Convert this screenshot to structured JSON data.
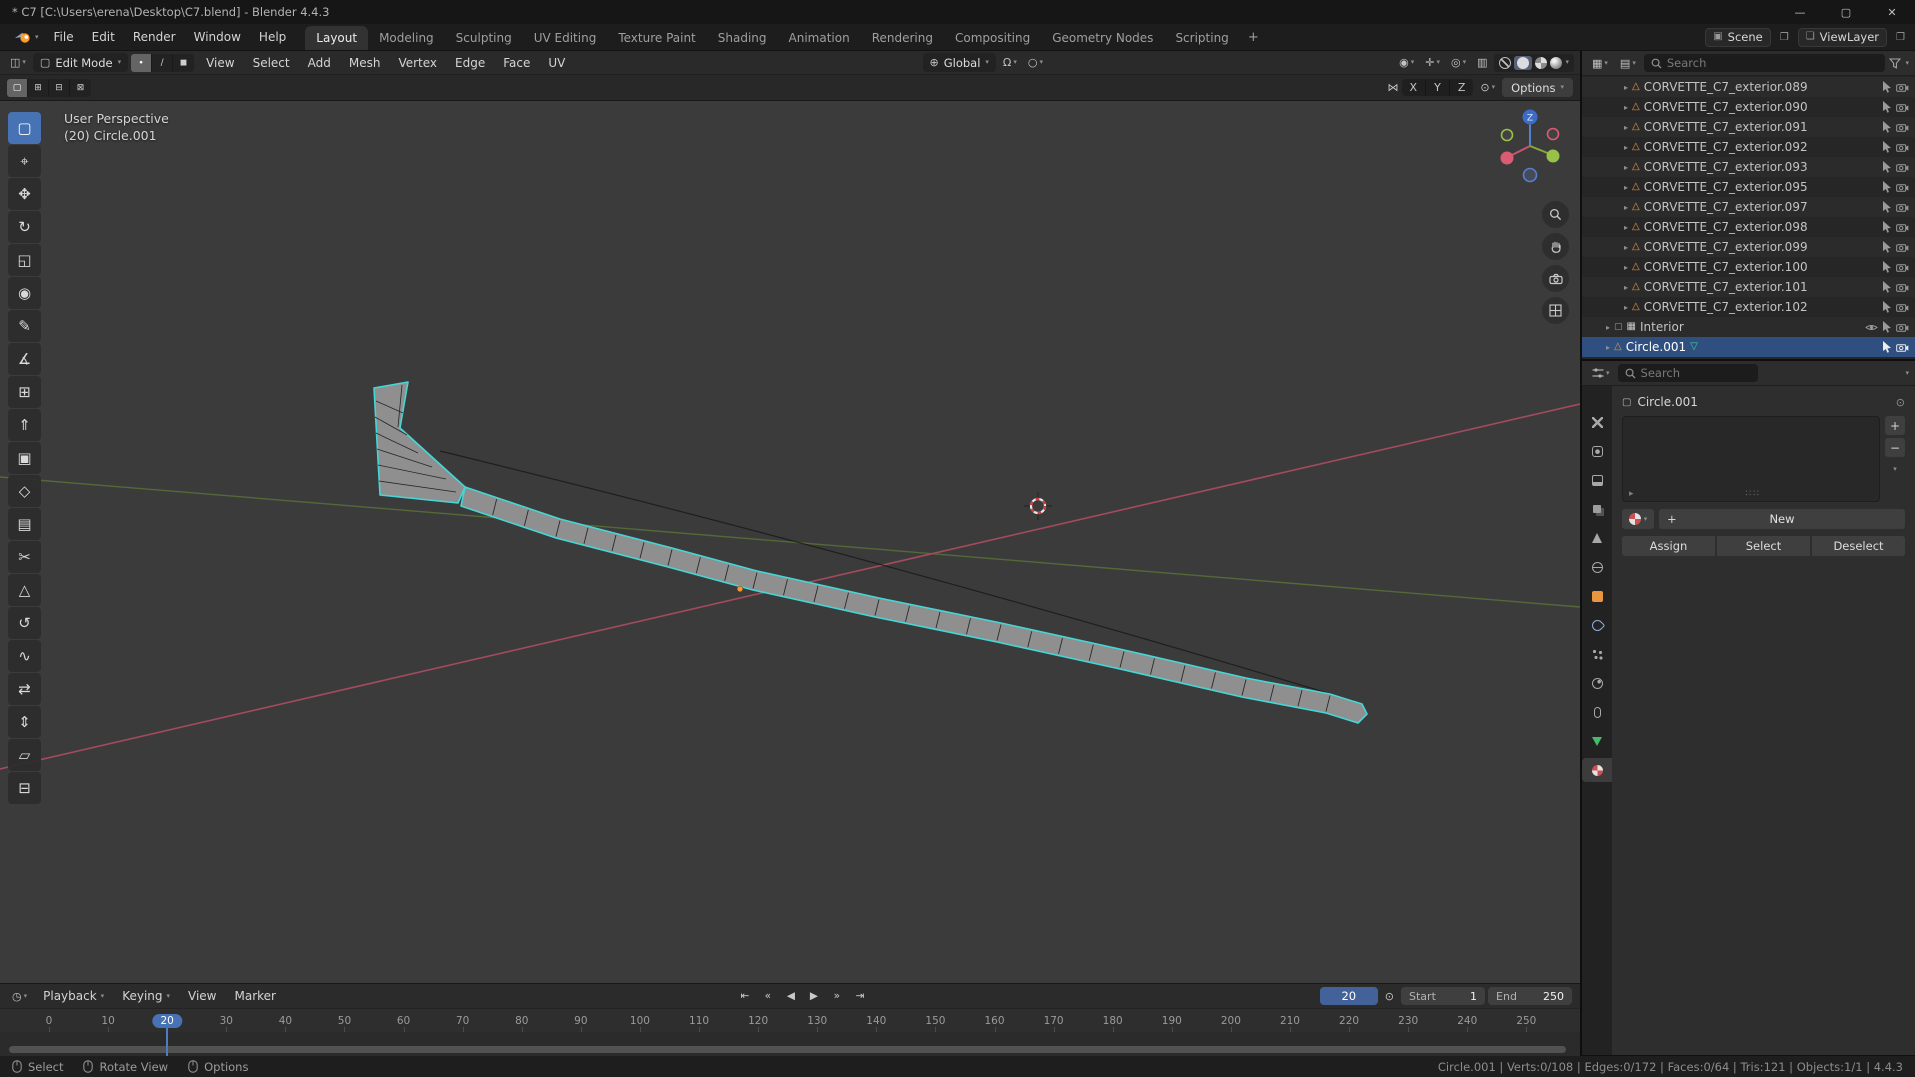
{
  "window": {
    "title": "* C7 [C:\\Users\\erena\\Desktop\\C7.blend] - Blender 4.4.3",
    "controls": {
      "minimize": "—",
      "maximize": "▢",
      "close": "✕"
    }
  },
  "icons": {
    "caret": "▾",
    "editor_3d": "◫",
    "edit_mode": "▢",
    "globe": "⊕",
    "magnet": "Ω",
    "prop_edit": "○",
    "visibility": "◉",
    "gizmo": "✛",
    "overlays": "◎",
    "xray": "▥",
    "disclosure": "▸",
    "mesh_object": "△",
    "mesh_data": "▽",
    "collection": "▦",
    "checkbox": "▢",
    "outliner_editor": "▦",
    "display_mode": "▤",
    "clock": "◷",
    "autokey": "⊙",
    "object_box": "▢",
    "pin": "⊙",
    "plus": "+",
    "minus": "−",
    "grip": "∷∷",
    "slot_expand": "▸",
    "mirror": "⋈",
    "snap_target": "⊙",
    "duplicate": "❐",
    "scene_icon": "▣",
    "viewlayer_icon": "❏"
  },
  "topbar": {
    "menus": [
      {
        "label": "File"
      },
      {
        "label": "Edit"
      },
      {
        "label": "Render"
      },
      {
        "label": "Window"
      },
      {
        "label": "Help"
      }
    ],
    "workspaces": [
      {
        "label": "Layout",
        "cls": "active"
      },
      {
        "label": "Modeling"
      },
      {
        "label": "Sculpting"
      },
      {
        "label": "UV Editing"
      },
      {
        "label": "Texture Paint"
      },
      {
        "label": "Shading"
      },
      {
        "label": "Animation"
      },
      {
        "label": "Rendering"
      },
      {
        "label": "Compositing"
      },
      {
        "label": "Geometry Nodes"
      },
      {
        "label": "Scripting"
      }
    ],
    "add_workspace": "+",
    "scene": {
      "label": "Scene"
    },
    "viewlayer": {
      "label": "ViewLayer"
    }
  },
  "viewport": {
    "header": {
      "mode": "Edit Mode",
      "select_modes": [
        {
          "name": "vertex-select-mode-button",
          "glyph": "∙",
          "cls": "active"
        },
        {
          "name": "edge-select-mode-button",
          "glyph": "∕"
        },
        {
          "name": "face-select-mode-button",
          "glyph": "◼"
        }
      ],
      "menus": [
        {
          "label": "View"
        },
        {
          "label": "Select"
        },
        {
          "label": "Add"
        },
        {
          "label": "Mesh"
        },
        {
          "label": "Vertex"
        },
        {
          "label": "Edge"
        },
        {
          "label": "Face"
        },
        {
          "label": "UV"
        }
      ],
      "orientation": "Global",
      "options_label": "Options",
      "mirror_axes": [
        {
          "label": "X",
          "name": "mirror-x-button"
        },
        {
          "label": "Y",
          "name": "mirror-y-button"
        },
        {
          "label": "Z",
          "name": "mirror-z-button"
        }
      ]
    },
    "toolrow_modes": [
      {
        "name": "select-mode-new-button",
        "glyph": "▢",
        "cls": "active"
      },
      {
        "name": "select-mode-extend-button",
        "glyph": "⊞"
      },
      {
        "name": "select-mode-subtract-button",
        "glyph": "⊟"
      },
      {
        "name": "select-mode-intersect-button",
        "glyph": "⊠"
      }
    ],
    "overlay": {
      "perspective": "User Perspective",
      "object_info": "(20) Circle.001"
    },
    "gizmo": {
      "z_label": "Z"
    },
    "toolbar": [
      {
        "name": "select-box-tool",
        "glyph": "▢",
        "cls": "active"
      },
      {
        "name": "cursor-tool",
        "glyph": "⌖"
      },
      {
        "name": "move-tool",
        "glyph": "✥"
      },
      {
        "name": "rotate-tool",
        "glyph": "↻"
      },
      {
        "name": "scale-tool",
        "glyph": "◱"
      },
      {
        "name": "transform-tool",
        "glyph": "◉"
      },
      {
        "name": "annotate-tool",
        "glyph": "✎"
      },
      {
        "name": "measure-tool",
        "glyph": "∡"
      },
      {
        "name": "add-cube-tool",
        "glyph": "⊞"
      },
      {
        "name": "extrude-region-tool",
        "glyph": "⇑"
      },
      {
        "name": "inset-faces-tool",
        "glyph": "▣"
      },
      {
        "name": "bevel-tool",
        "glyph": "◇"
      },
      {
        "name": "loop-cut-tool",
        "glyph": "▤"
      },
      {
        "name": "knife-tool",
        "glyph": "✂"
      },
      {
        "name": "poly-build-tool",
        "glyph": "△"
      },
      {
        "name": "spin-tool",
        "glyph": "↺"
      },
      {
        "name": "smooth-tool",
        "glyph": "∿"
      },
      {
        "name": "edge-slide-tool",
        "glyph": "⇄"
      },
      {
        "name": "shrink-fatten-tool",
        "glyph": "⇕"
      },
      {
        "name": "shear-tool",
        "glyph": "▱"
      },
      {
        "name": "rip-region-tool",
        "glyph": "⊟"
      }
    ]
  },
  "outliner": {
    "search_placeholder": "Search",
    "rows": [
      {
        "label": "CORVETTE_C7_exterior.089",
        "ind": "ind2",
        "is_object": 1
      },
      {
        "label": "CORVETTE_C7_exterior.090",
        "ind": "ind2",
        "is_object": 1
      },
      {
        "label": "CORVETTE_C7_exterior.091",
        "ind": "ind2",
        "is_object": 1
      },
      {
        "label": "CORVETTE_C7_exterior.092",
        "ind": "ind2",
        "is_object": 1
      },
      {
        "label": "CORVETTE_C7_exterior.093",
        "ind": "ind2",
        "is_object": 1
      },
      {
        "label": "CORVETTE_C7_exterior.095",
        "ind": "ind2",
        "is_object": 1
      },
      {
        "label": "CORVETTE_C7_exterior.097",
        "ind": "ind2",
        "is_object": 1
      },
      {
        "label": "CORVETTE_C7_exterior.098",
        "ind": "ind2",
        "is_object": 1
      },
      {
        "label": "CORVETTE_C7_exterior.099",
        "ind": "ind2",
        "is_object": 1
      },
      {
        "label": "CORVETTE_C7_exterior.100",
        "ind": "ind2",
        "is_object": 1
      },
      {
        "label": "CORVETTE_C7_exterior.101",
        "ind": "ind2",
        "is_object": 1
      },
      {
        "label": "CORVETTE_C7_exterior.102",
        "ind": "ind2",
        "is_object": 1
      },
      {
        "label": "Interior",
        "ind": "ind1",
        "is_collection": 1,
        "has_checkbox": 1,
        "has_eye": 1
      },
      {
        "label": "Circle.001",
        "ind": "ind1",
        "is_object": 1,
        "has_data_icon": 1,
        "cls": "selected"
      }
    ]
  },
  "properties": {
    "search_placeholder": "Search",
    "breadcrumb": "Circle.001",
    "tabs": [
      {
        "name": "tool-tab",
        "shape": "s-tool"
      },
      {
        "name": "render-tab",
        "shape": "s-render"
      },
      {
        "name": "output-tab",
        "shape": "s-output"
      },
      {
        "name": "view-layer-tab",
        "shape": "s-layers"
      },
      {
        "name": "scene-tab",
        "shape": "s-scene"
      },
      {
        "name": "world-tab",
        "shape": "s-world"
      },
      {
        "name": "object-tab",
        "shape": "s-object"
      },
      {
        "name": "modifiers-tab",
        "shape": "s-mod"
      },
      {
        "name": "particles-tab",
        "shape": "s-part"
      },
      {
        "name": "physics-tab",
        "shape": "s-phys"
      },
      {
        "name": "constraints-tab",
        "shape": "s-constraint"
      },
      {
        "name": "object-data-tab",
        "shape": "s-data"
      },
      {
        "name": "material-tab",
        "shape": "s-material",
        "cls": "active"
      }
    ],
    "material": {
      "new_label": "New",
      "assign_label": "Assign",
      "select_label": "Select",
      "deselect_label": "Deselect"
    }
  },
  "timeline": {
    "menus": [
      {
        "label": "Playback",
        "caret": 1
      },
      {
        "label": "Keying",
        "caret": 1
      },
      {
        "label": "View"
      },
      {
        "label": "Marker"
      }
    ],
    "transport": [
      {
        "name": "jump-to-start-button",
        "glyph": "⇤"
      },
      {
        "name": "previous-keyframe-button",
        "glyph": "«"
      },
      {
        "name": "play-reverse-button",
        "glyph": "◀"
      },
      {
        "name": "play-forward-button",
        "glyph": "▶"
      },
      {
        "name": "next-keyframe-button",
        "glyph": "»"
      },
      {
        "name": "jump-to-end-button",
        "glyph": "⇥"
      }
    ],
    "current_frame": "20",
    "start_label": "Start",
    "start_value": "1",
    "end_label": "End",
    "end_value": "250",
    "ticks": [
      {
        "label": "0"
      },
      {
        "label": "10"
      },
      {
        "label": "20",
        "cls": "current"
      },
      {
        "label": "30"
      },
      {
        "label": "40"
      },
      {
        "label": "50"
      },
      {
        "label": "60"
      },
      {
        "label": "70"
      },
      {
        "label": "80"
      },
      {
        "label": "90"
      },
      {
        "label": "100"
      },
      {
        "label": "110"
      },
      {
        "label": "120"
      },
      {
        "label": "130"
      },
      {
        "label": "140"
      },
      {
        "label": "150"
      },
      {
        "label": "160"
      },
      {
        "label": "170"
      },
      {
        "label": "180"
      },
      {
        "label": "190"
      },
      {
        "label": "200"
      },
      {
        "label": "210"
      },
      {
        "label": "220"
      },
      {
        "label": "230"
      },
      {
        "label": "240"
      },
      {
        "label": "250"
      }
    ]
  },
  "statusbar": {
    "hints": [
      {
        "label": "Select",
        "icon": "mouse-left-icon"
      },
      {
        "label": "Rotate View",
        "icon": "mouse-middle-icon"
      },
      {
        "label": "Options",
        "icon": "mouse-right-icon"
      }
    ],
    "info": "Circle.001 | Verts:0/108 | Edges:0/172 | Faces:0/64 | Tris:121 | Objects:1/1 | 4.4.3"
  },
  "colors": {
    "accent": "#4772b3",
    "selection": "#2f4f80",
    "mesh_edge": "#45d6d6",
    "object_orange": "#e8963f",
    "mesh_data_green": "#3fd08c",
    "axis_x": "#a34b5e",
    "axis_y": "#566e37",
    "playhead": "#4f7ac4"
  }
}
